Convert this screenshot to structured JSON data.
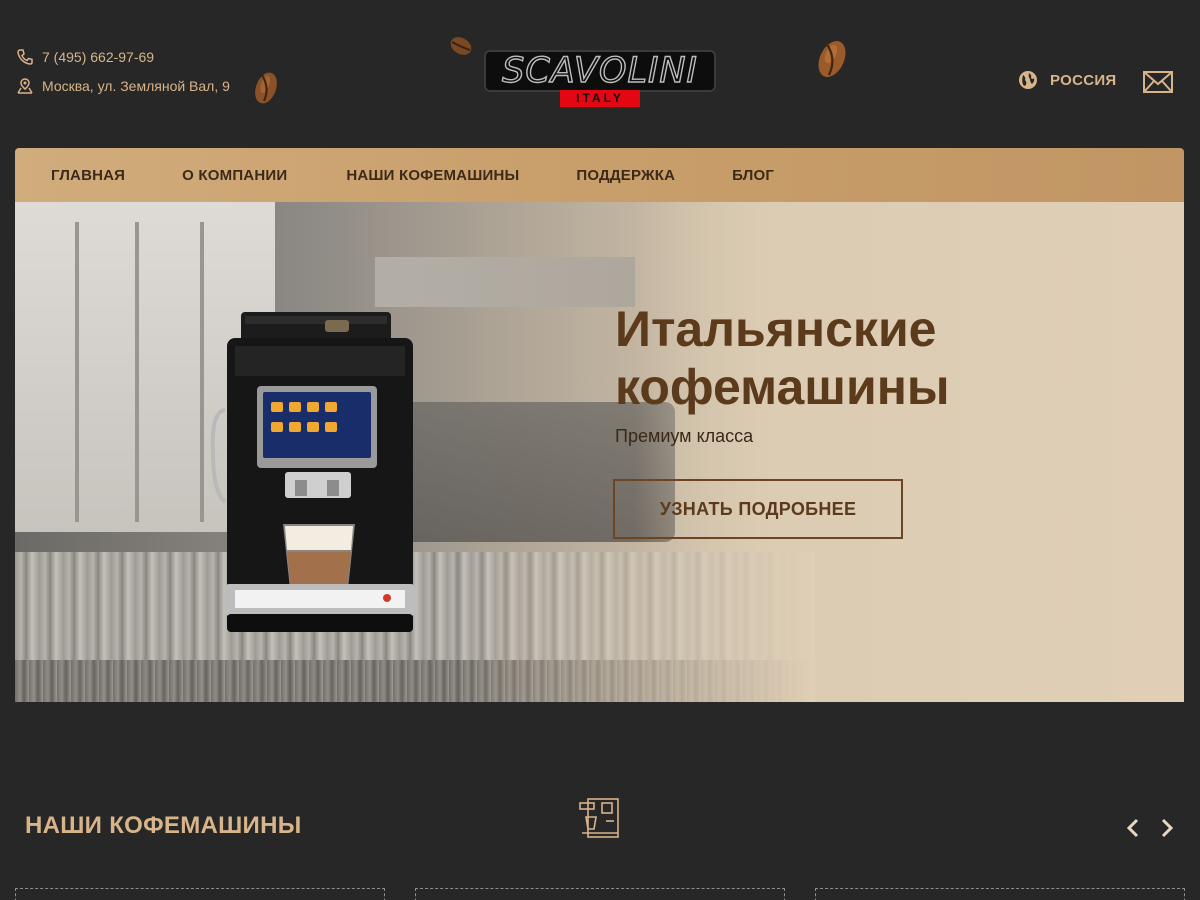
{
  "header": {
    "phone": "7 (495) 662-97-69",
    "address": "Москва, ул. Земляной Вал, 9",
    "logo": {
      "wordmark": "SCAVOLINI",
      "tag": "ITALY"
    },
    "region_label": "РОССИЯ",
    "icons": [
      "phone-icon",
      "location-icon",
      "globe-icon",
      "mail-icon"
    ]
  },
  "nav": {
    "items": [
      {
        "label": "ГЛАВНАЯ"
      },
      {
        "label": "О КОМПАНИИ"
      },
      {
        "label": "НАШИ КОФЕМАШИНЫ"
      },
      {
        "label": "ПОДДЕРЖКА"
      },
      {
        "label": "БЛОГ"
      }
    ]
  },
  "hero": {
    "title": "Итальянские кофемашины",
    "subtitle": "Премиум класса",
    "cta_label": "УЗНАТЬ ПОДРОБНЕЕ"
  },
  "section": {
    "title": "НАШИ КОФЕМАШИНЫ",
    "icon": "coffee-machine-icon",
    "controls": [
      "chevron-left-icon",
      "chevron-right-icon"
    ]
  },
  "colors": {
    "background": "#272727",
    "accent_text": "#d8b48a",
    "nav_bar": "#c89e6a",
    "hero_title": "#5c3b1c",
    "logo_red": "#e30613"
  }
}
